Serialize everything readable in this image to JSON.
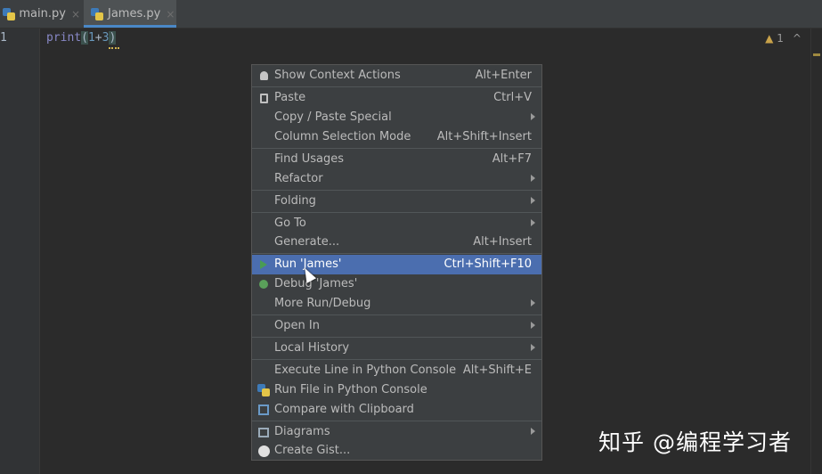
{
  "tabs": [
    {
      "label": "main.py",
      "close": "×"
    },
    {
      "label": "James.py",
      "close": "×"
    }
  ],
  "editor": {
    "line_number": "1",
    "code": {
      "fn": "print",
      "open": "(",
      "a": "1",
      "op": "+",
      "b": "3",
      "close": ")"
    },
    "warning_count": "1",
    "nav_up": "^",
    "nav_down": "v"
  },
  "menu": {
    "items": [
      {
        "label": "Show Context Actions",
        "shortcut": "Alt+Enter",
        "icon": "bulb-icon"
      },
      {
        "label": "Paste",
        "shortcut": "Ctrl+V",
        "icon": "clipboard-icon"
      },
      {
        "label": "Copy / Paste Special",
        "shortcut": "",
        "submenu": true
      },
      {
        "label": "Column Selection Mode",
        "shortcut": "Alt+Shift+Insert"
      },
      {
        "label": "Find Usages",
        "shortcut": "Alt+F7"
      },
      {
        "label": "Refactor",
        "shortcut": "",
        "submenu": true
      },
      {
        "label": "Folding",
        "shortcut": "",
        "submenu": true
      },
      {
        "label": "Go To",
        "shortcut": "",
        "submenu": true
      },
      {
        "label": "Generate...",
        "shortcut": "Alt+Insert"
      },
      {
        "label": "Run 'James'",
        "shortcut": "Ctrl+Shift+F10",
        "icon": "run-icon",
        "selected": true
      },
      {
        "label": "Debug 'James'",
        "shortcut": "",
        "icon": "debug-icon"
      },
      {
        "label": "More Run/Debug",
        "shortcut": "",
        "submenu": true
      },
      {
        "label": "Open In",
        "shortcut": "",
        "submenu": true
      },
      {
        "label": "Local History",
        "shortcut": "",
        "submenu": true
      },
      {
        "label": "Execute Line in Python Console",
        "shortcut": "Alt+Shift+E"
      },
      {
        "label": "Run File in Python Console",
        "shortcut": "",
        "icon": "python-icon"
      },
      {
        "label": "Compare with Clipboard",
        "shortcut": "",
        "icon": "compare-icon"
      },
      {
        "label": "Diagrams",
        "shortcut": "",
        "icon": "diagram-icon",
        "submenu": true
      },
      {
        "label": "Create Gist...",
        "shortcut": "",
        "icon": "github-icon"
      }
    ]
  },
  "watermark": "知乎 @编程学习者",
  "colors": {
    "selection": "#4b6eaf",
    "menu_bg": "#3c3f41",
    "editor_bg": "#2b2b2b"
  }
}
